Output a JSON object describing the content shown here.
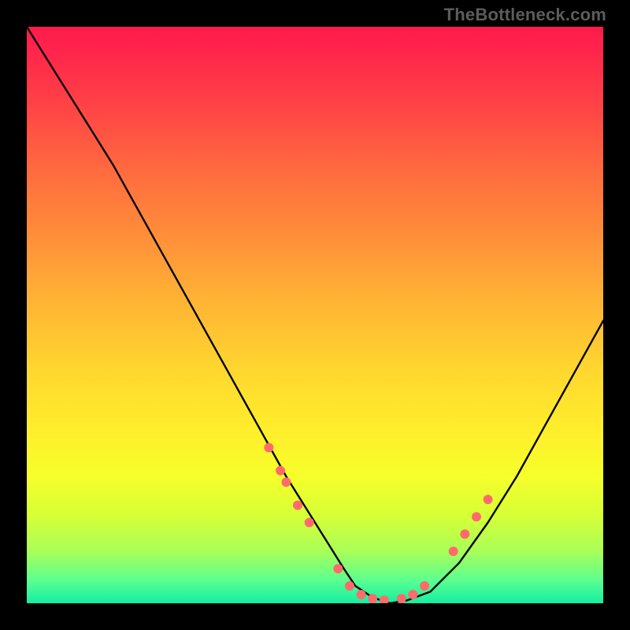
{
  "watermark": "TheBottleneck.com",
  "chart_data": {
    "type": "line",
    "title": "",
    "xlabel": "",
    "ylabel": "",
    "xlim": [
      0,
      100
    ],
    "ylim": [
      0,
      100
    ],
    "grid": false,
    "series": [
      {
        "name": "curve",
        "x": [
          0,
          5,
          10,
          15,
          20,
          25,
          30,
          35,
          40,
          45,
          50,
          55,
          57,
          60,
          63,
          66,
          70,
          75,
          80,
          85,
          90,
          95,
          100
        ],
        "y": [
          100,
          92,
          84,
          76,
          67,
          58,
          49,
          40,
          31,
          22,
          14,
          6,
          3,
          1,
          0,
          0.5,
          2,
          7,
          14,
          22,
          31,
          40,
          49
        ]
      }
    ],
    "markers": {
      "name": "dots",
      "color": "#ff6b6b",
      "radius": 6,
      "points": [
        {
          "x": 42,
          "y": 27
        },
        {
          "x": 44,
          "y": 23
        },
        {
          "x": 45,
          "y": 21
        },
        {
          "x": 47,
          "y": 17
        },
        {
          "x": 49,
          "y": 14
        },
        {
          "x": 54,
          "y": 6
        },
        {
          "x": 56,
          "y": 3
        },
        {
          "x": 58,
          "y": 1.5
        },
        {
          "x": 60,
          "y": 0.8
        },
        {
          "x": 62,
          "y": 0.5
        },
        {
          "x": 65,
          "y": 0.8
        },
        {
          "x": 67,
          "y": 1.5
        },
        {
          "x": 69,
          "y": 3
        },
        {
          "x": 74,
          "y": 9
        },
        {
          "x": 76,
          "y": 12
        },
        {
          "x": 78,
          "y": 15
        },
        {
          "x": 80,
          "y": 18
        }
      ]
    },
    "background_gradient": {
      "top": "#ff1a4d",
      "bottom": "#13efa2"
    }
  }
}
